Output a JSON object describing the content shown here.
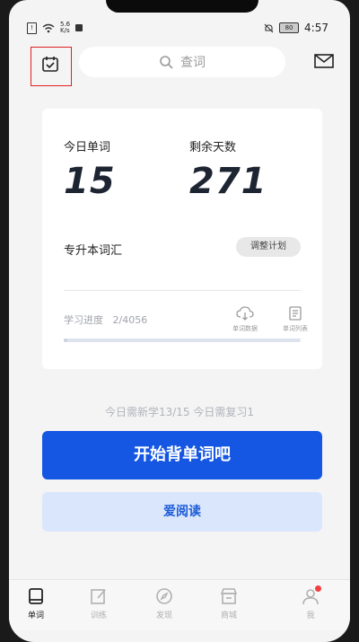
{
  "status_bar": {
    "net_speed_top": "5.6",
    "net_speed_bottom": "K/s",
    "battery": "80",
    "time": "4:57"
  },
  "header": {
    "search_placeholder": "查词"
  },
  "stats": {
    "today_words_label": "今日单词",
    "today_words_value": "15",
    "days_left_label": "剩余天数",
    "days_left_value": "271"
  },
  "plan": {
    "book_name": "专升本词汇",
    "adjust_label": "调整计划"
  },
  "progress": {
    "label": "学习进度",
    "value": "2/4056",
    "fraction": 0.0005,
    "data_label": "单词数据",
    "list_label": "单词列表"
  },
  "daily_summary": "今日需新学13/15  今日需复习1",
  "start_button": "开始背单词吧",
  "read_button": "爱阅读",
  "tabs": [
    {
      "label": "单词",
      "icon": "book-icon"
    },
    {
      "label": "训练",
      "icon": "edit-icon"
    },
    {
      "label": "发现",
      "icon": "compass-icon"
    },
    {
      "label": "商城",
      "icon": "store-icon"
    },
    {
      "label": "我",
      "icon": "user-icon"
    }
  ],
  "colors": {
    "primary": "#1557e2",
    "secondary_bg": "#d9e6fb",
    "highlight_box": "#e02020",
    "badge": "#f04040"
  }
}
